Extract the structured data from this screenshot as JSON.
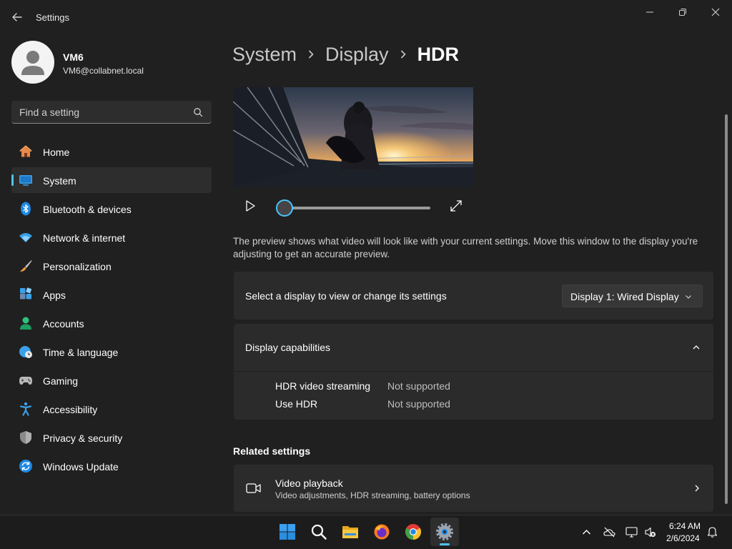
{
  "window": {
    "title": "Settings"
  },
  "profile": {
    "name": "VM6",
    "email": "VM6@collabnet.local"
  },
  "search": {
    "placeholder": "Find a setting"
  },
  "sidebar": {
    "items": [
      {
        "label": "Home",
        "icon": "home-icon",
        "active": false
      },
      {
        "label": "System",
        "icon": "system-icon",
        "active": true
      },
      {
        "label": "Bluetooth & devices",
        "icon": "bluetooth-icon",
        "active": false
      },
      {
        "label": "Network & internet",
        "icon": "wifi-icon",
        "active": false
      },
      {
        "label": "Personalization",
        "icon": "brush-icon",
        "active": false
      },
      {
        "label": "Apps",
        "icon": "apps-icon",
        "active": false
      },
      {
        "label": "Accounts",
        "icon": "accounts-icon",
        "active": false
      },
      {
        "label": "Time & language",
        "icon": "globe-clock-icon",
        "active": false
      },
      {
        "label": "Gaming",
        "icon": "gamepad-icon",
        "active": false
      },
      {
        "label": "Accessibility",
        "icon": "accessibility-icon",
        "active": false
      },
      {
        "label": "Privacy & security",
        "icon": "shield-icon",
        "active": false
      },
      {
        "label": "Windows Update",
        "icon": "update-icon",
        "active": false
      }
    ]
  },
  "breadcrumb": {
    "items": [
      "System",
      "Display",
      "HDR"
    ]
  },
  "preview": {
    "description": "The preview shows what video will look like with your current settings. Move this window to the display you're adjusting to get an accurate preview.",
    "progress": 0
  },
  "display_select": {
    "label": "Select a display to view or change its settings",
    "selected": "Display 1: Wired Display"
  },
  "capabilities": {
    "title": "Display capabilities",
    "expanded": true,
    "rows": [
      {
        "label": "HDR video streaming",
        "value": "Not supported"
      },
      {
        "label": "Use HDR",
        "value": "Not supported"
      }
    ]
  },
  "related": {
    "title": "Related settings",
    "items": [
      {
        "title": "Video playback",
        "subtitle": "Video adjustments, HDR streaming, battery options"
      }
    ]
  },
  "taskbar": {
    "apps": [
      "windows-start-icon",
      "search-icon",
      "file-explorer-icon",
      "firefox-icon",
      "chrome-icon",
      "settings-gear-icon"
    ],
    "time": "6:24 AM",
    "date": "2/6/2024"
  },
  "colors": {
    "accent": "#4cc2ff",
    "background": "#202020",
    "card": "#2b2b2b"
  }
}
